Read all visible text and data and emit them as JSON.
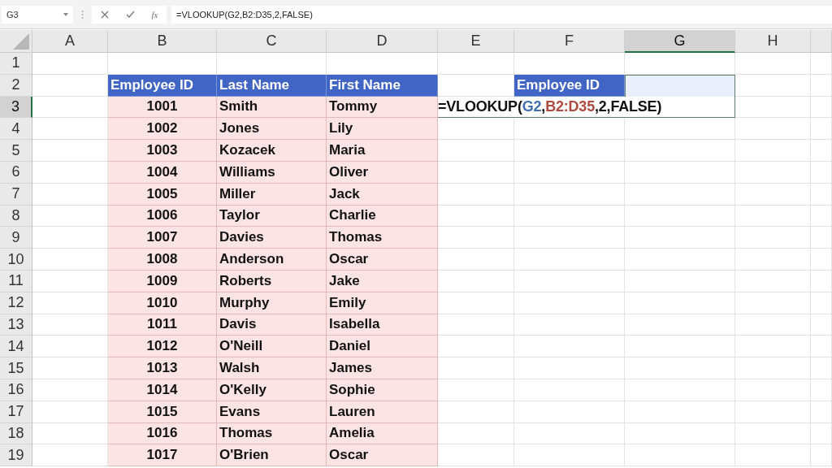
{
  "formula_bar": {
    "name_box": "G3",
    "function_label": "fx",
    "formula": "=VLOOKUP(G2,B2:D35,2,FALSE)"
  },
  "columns": [
    {
      "label": "A",
      "selected": false
    },
    {
      "label": "B",
      "selected": false
    },
    {
      "label": "C",
      "selected": false
    },
    {
      "label": "D",
      "selected": false
    },
    {
      "label": "E",
      "selected": false
    },
    {
      "label": "F",
      "selected": false
    },
    {
      "label": "G",
      "selected": true
    },
    {
      "label": "H",
      "selected": false
    }
  ],
  "rows": [
    {
      "label": "1",
      "selected": false
    },
    {
      "label": "2",
      "selected": false
    },
    {
      "label": "3",
      "selected": true
    },
    {
      "label": "4",
      "selected": false
    },
    {
      "label": "5",
      "selected": false
    },
    {
      "label": "6",
      "selected": false
    },
    {
      "label": "7",
      "selected": false
    },
    {
      "label": "8",
      "selected": false
    },
    {
      "label": "9",
      "selected": false
    },
    {
      "label": "10",
      "selected": false
    },
    {
      "label": "11",
      "selected": false
    },
    {
      "label": "12",
      "selected": false
    },
    {
      "label": "13",
      "selected": false
    },
    {
      "label": "14",
      "selected": false
    },
    {
      "label": "15",
      "selected": false
    },
    {
      "label": "16",
      "selected": false
    },
    {
      "label": "17",
      "selected": false
    },
    {
      "label": "18",
      "selected": false
    },
    {
      "label": "19",
      "selected": false
    }
  ],
  "table": {
    "columns": [
      "Employee ID",
      "Last Name",
      "First Name"
    ],
    "rows": [
      [
        "1001",
        "Smith",
        "Tommy"
      ],
      [
        "1002",
        "Jones",
        "Lily"
      ],
      [
        "1003",
        "Kozacek",
        "Maria"
      ],
      [
        "1004",
        "Williams",
        "Oliver"
      ],
      [
        "1005",
        "Miller",
        "Jack"
      ],
      [
        "1006",
        "Taylor",
        "Charlie"
      ],
      [
        "1007",
        "Davies",
        "Thomas"
      ],
      [
        "1008",
        "Anderson",
        "Oscar"
      ],
      [
        "1009",
        "Roberts",
        "Jake"
      ],
      [
        "1010",
        "Murphy",
        "Emily"
      ],
      [
        "1011",
        "Davis",
        "Isabella"
      ],
      [
        "1012",
        "O'Neill",
        "Daniel"
      ],
      [
        "1013",
        "Walsh",
        "James"
      ],
      [
        "1014",
        "O'Kelly",
        "Sophie"
      ],
      [
        "1015",
        "Evans",
        "Lauren"
      ],
      [
        "1016",
        "Thomas",
        "Amelia"
      ],
      [
        "1017",
        "O'Brien",
        "Oscar"
      ]
    ]
  },
  "lookup": {
    "label": "Employee ID"
  },
  "cell_formula": [
    {
      "text": "=VLOOKUP(",
      "color": "#111111"
    },
    {
      "text": "G2",
      "color": "#3f6fb0"
    },
    {
      "text": ",",
      "color": "#111111"
    },
    {
      "text": "B2:D35",
      "color": "#b04a3f"
    },
    {
      "text": ",2,FALSE)",
      "color": "#111111"
    }
  ]
}
